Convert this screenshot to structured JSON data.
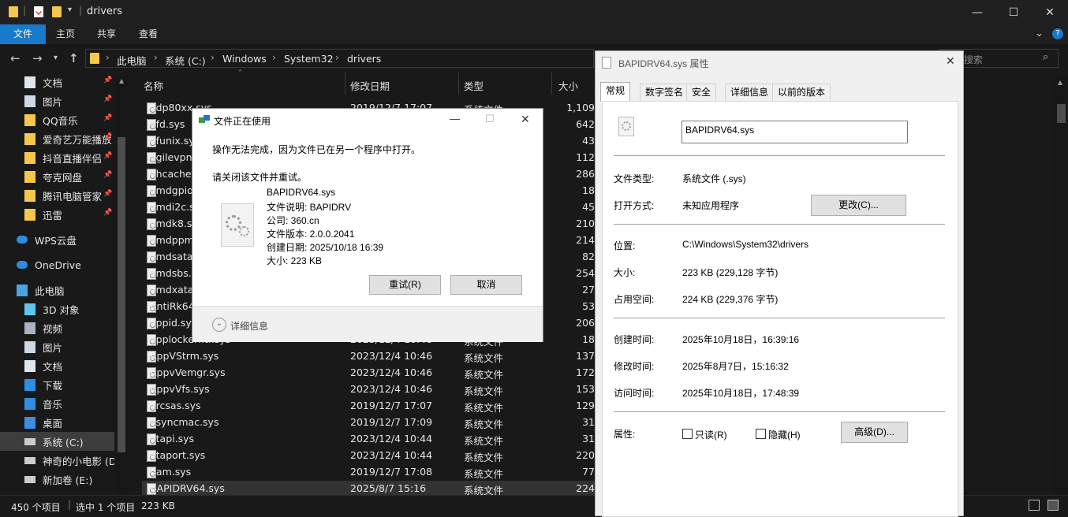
{
  "window": {
    "title": "drivers",
    "minimize": "—",
    "maximize": "☐",
    "close": "✕"
  },
  "ribbon": {
    "tabs": [
      "文件",
      "主页",
      "共享",
      "查看"
    ],
    "expand": "⌄",
    "help": "?"
  },
  "address": {
    "crumbs": [
      "此电脑",
      "系统 (C:)",
      "Windows",
      "System32",
      "drivers"
    ],
    "search_placeholder": "搜索"
  },
  "sidebar": {
    "items": [
      {
        "label": "文档",
        "icon": "document-icon",
        "pinned": true
      },
      {
        "label": "图片",
        "icon": "picture-icon",
        "pinned": true
      },
      {
        "label": "QQ音乐",
        "icon": "folder-icon",
        "pinned": true
      },
      {
        "label": "爱奇艺万能播放",
        "icon": "folder-icon",
        "pinned": true
      },
      {
        "label": "抖音直播伴侣",
        "icon": "folder-icon",
        "pinned": true
      },
      {
        "label": "夸克网盘",
        "icon": "folder-icon",
        "pinned": true
      },
      {
        "label": "腾讯电脑管家",
        "icon": "folder-icon",
        "pinned": true
      },
      {
        "label": "迅雷",
        "icon": "folder-icon",
        "pinned": true
      },
      {
        "label": "WPS云盘",
        "icon": "cloud-icon",
        "pinned": false
      },
      {
        "label": "OneDrive",
        "icon": "cloud-icon",
        "pinned": false
      },
      {
        "label": "此电脑",
        "icon": "computer-icon",
        "pinned": false
      },
      {
        "label": "3D 对象",
        "icon": "cube-icon",
        "pinned": false
      },
      {
        "label": "视频",
        "icon": "video-icon",
        "pinned": false
      },
      {
        "label": "图片",
        "icon": "picture-icon",
        "pinned": false
      },
      {
        "label": "文档",
        "icon": "document-icon",
        "pinned": false
      },
      {
        "label": "下载",
        "icon": "download-icon",
        "pinned": false
      },
      {
        "label": "音乐",
        "icon": "music-icon",
        "pinned": false
      },
      {
        "label": "桌面",
        "icon": "desktop-icon",
        "pinned": false
      },
      {
        "label": "系统 (C:)",
        "icon": "drive-icon",
        "pinned": false
      },
      {
        "label": "神奇的小电影 (D:",
        "icon": "drive-icon",
        "pinned": false
      },
      {
        "label": "新加卷 (E:)",
        "icon": "drive-icon",
        "pinned": false
      }
    ]
  },
  "filelist": {
    "columns": [
      "名称",
      "修改日期",
      "类型",
      "大小"
    ],
    "rows": [
      {
        "name": "adp80xx.sys",
        "date": "2019/12/7 17:07",
        "type": "系统文件",
        "size": "1,109"
      },
      {
        "name": "afd.sys",
        "date": "",
        "type": "",
        "size": "642"
      },
      {
        "name": "afunix.sys",
        "date": "",
        "type": "",
        "size": "43"
      },
      {
        "name": "agilevpn.sys",
        "date": "",
        "type": "",
        "size": "112"
      },
      {
        "name": "ahcache.sys",
        "date": "",
        "type": "",
        "size": "286"
      },
      {
        "name": "amdgpio2.sys",
        "date": "",
        "type": "",
        "size": "18"
      },
      {
        "name": "amdi2c.sys",
        "date": "",
        "type": "",
        "size": "45"
      },
      {
        "name": "amdk8.sys",
        "date": "",
        "type": "",
        "size": "210"
      },
      {
        "name": "amdppm.sys",
        "date": "",
        "type": "",
        "size": "214"
      },
      {
        "name": "amdsata.sys",
        "date": "",
        "type": "",
        "size": "82"
      },
      {
        "name": "amdsbs.sys",
        "date": "",
        "type": "",
        "size": "254"
      },
      {
        "name": "amdxata.sys",
        "date": "",
        "type": "",
        "size": "27"
      },
      {
        "name": "AntiRk64.sys",
        "date": "",
        "type": "",
        "size": "53"
      },
      {
        "name": "appid.sys",
        "date": "",
        "type": "",
        "size": "206"
      },
      {
        "name": "applockerfltr.sys",
        "date": "2023/12/4 10:46",
        "type": "系统文件",
        "size": "18"
      },
      {
        "name": "AppVStrm.sys",
        "date": "2023/12/4 10:46",
        "type": "系统文件",
        "size": "137"
      },
      {
        "name": "AppvVemgr.sys",
        "date": "2023/12/4 10:46",
        "type": "系统文件",
        "size": "172"
      },
      {
        "name": "AppvVfs.sys",
        "date": "2023/12/4 10:46",
        "type": "系统文件",
        "size": "153"
      },
      {
        "name": "arcsas.sys",
        "date": "2019/12/7 17:07",
        "type": "系统文件",
        "size": "129"
      },
      {
        "name": "asyncmac.sys",
        "date": "2019/12/7 17:09",
        "type": "系统文件",
        "size": "31"
      },
      {
        "name": "atapi.sys",
        "date": "2023/12/4 10:44",
        "type": "系统文件",
        "size": "31"
      },
      {
        "name": "ataport.sys",
        "date": "2023/12/4 10:44",
        "type": "系统文件",
        "size": "220"
      },
      {
        "name": "bam.sys",
        "date": "2019/12/7 17:08",
        "type": "系统文件",
        "size": "77"
      },
      {
        "name": "BAPIDRV64.sys",
        "date": "2025/8/7 15:16",
        "type": "系统文件",
        "size": "224"
      }
    ]
  },
  "status": {
    "count": "450 个项目",
    "selected": "选中 1 个项目",
    "size": "223 KB"
  },
  "props": {
    "title": "BAPIDRV64.sys 属性",
    "close": "✕",
    "tabs": [
      "常规",
      "数字签名",
      "安全",
      "详细信息",
      "以前的版本"
    ],
    "filename": "BAPIDRV64.sys",
    "type_label": "文件类型:",
    "type_value": "系统文件 (.sys)",
    "open_label": "打开方式:",
    "open_value": "未知应用程序",
    "change_btn": "更改(C)...",
    "location_label": "位置:",
    "location_value": "C:\\Windows\\System32\\drivers",
    "size_label": "大小:",
    "size_value": "223 KB (229,128 字节)",
    "disk_label": "占用空间:",
    "disk_value": "224 KB (229,376 字节)",
    "created_label": "创建时间:",
    "created_value": "2025年10月18日，16:39:16",
    "modified_label": "修改时间:",
    "modified_value": "2025年8月7日，15:16:32",
    "accessed_label": "访问时间:",
    "accessed_value": "2025年10月18日，17:48:39",
    "attr_label": "属性:",
    "readonly": "只读(R)",
    "hidden": "隐藏(H)",
    "advanced_btn": "高级(D)..."
  },
  "inuse": {
    "title": "文件正在使用",
    "message": "操作无法完成，因为文件已在另一个程序中打开。",
    "instruction": "请关闭该文件并重试。",
    "file_name": "BAPIDRV64.sys",
    "desc": "文件说明: BAPIDRV",
    "company": "公司: 360.cn",
    "version": "文件版本: 2.0.0.2041",
    "created": "创建日期: 2025/10/18 16:39",
    "size": "大小: 223 KB",
    "retry_btn": "重试(R)",
    "cancel_btn": "取消",
    "details": "详细信息",
    "minimize": "—",
    "maximize": "☐",
    "close": "✕"
  }
}
